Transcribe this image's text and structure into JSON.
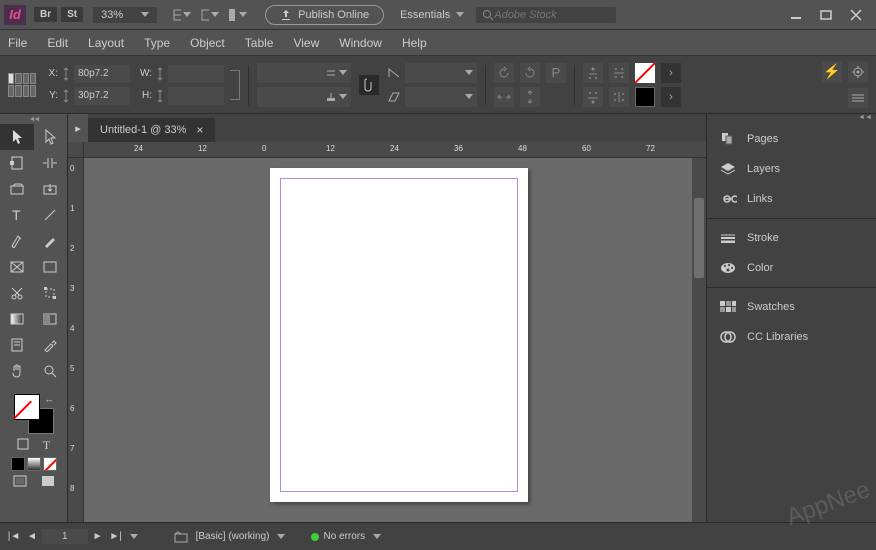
{
  "app": {
    "zoom": "33%",
    "publish_label": "Publish Online",
    "workspace": "Essentials",
    "search_placeholder": "Adobe Stock",
    "br_chip": "Br",
    "st_chip": "St"
  },
  "menu": {
    "file": "File",
    "edit": "Edit",
    "layout": "Layout",
    "type": "Type",
    "object": "Object",
    "table": "Table",
    "view": "View",
    "window": "Window",
    "help": "Help"
  },
  "controls": {
    "x": "80p7.2",
    "y": "30p7.2",
    "w": "",
    "h": "",
    "x_label": "X:",
    "y_label": "Y:",
    "w_label": "W:",
    "h_label": "H:"
  },
  "tab": {
    "title": "Untitled-1 @ 33%"
  },
  "h_ticks": [
    "24",
    "12",
    "0",
    "12",
    "24",
    "36",
    "48",
    "60",
    "72"
  ],
  "v_ticks": [
    "0",
    "1",
    "2",
    "3",
    "4",
    "5",
    "6",
    "7",
    "8"
  ],
  "panels": {
    "pages": "Pages",
    "layers": "Layers",
    "links": "Links",
    "stroke": "Stroke",
    "color": "Color",
    "swatches": "Swatches",
    "cc": "CC Libraries"
  },
  "status": {
    "page": "1",
    "preflight": "[Basic] (working)",
    "errors": "No errors"
  }
}
